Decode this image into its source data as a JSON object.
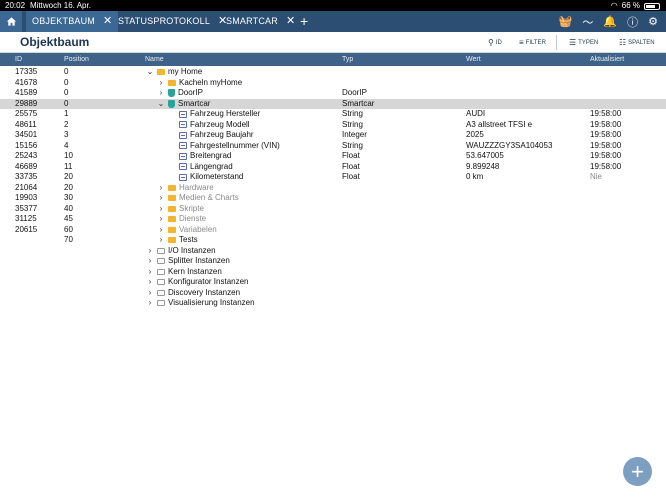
{
  "status": {
    "time": "20:02",
    "date": "Mittwoch 16. Apr.",
    "battery": "66 %"
  },
  "tabs": [
    {
      "label": "OBJEKTBAUM",
      "active": true
    },
    {
      "label": "STATUSPROTOKOLL",
      "active": false
    },
    {
      "label": "SMARTCAR",
      "active": false
    }
  ],
  "header": {
    "title": "Objektbaum",
    "id_btn": "ID",
    "filter_btn": "FILTER",
    "typen_btn": "TYPEN",
    "spalten_btn": "SPALTEN"
  },
  "columns": {
    "id": "ID",
    "position": "Position",
    "name": "Name",
    "typ": "Typ",
    "wert": "Wert",
    "aktualisiert": "Aktualisiert"
  },
  "rows": [
    {
      "id": "17335",
      "pos": "0",
      "name": "my Home",
      "typ": "",
      "wert": "",
      "akt": "",
      "indent": 0,
      "chev": "v",
      "icon": "folder",
      "muted": false,
      "sel": false
    },
    {
      "id": "41678",
      "pos": "0",
      "name": "Kacheln myHome",
      "typ": "",
      "wert": "",
      "akt": "",
      "indent": 1,
      "chev": ">",
      "icon": "folder",
      "muted": false,
      "sel": false
    },
    {
      "id": "41589",
      "pos": "0",
      "name": "DoorIP",
      "typ": "DoorIP",
      "wert": "",
      "akt": "",
      "indent": 1,
      "chev": ">",
      "icon": "inst",
      "muted": false,
      "sel": false
    },
    {
      "id": "29889",
      "pos": "0",
      "name": "Smartcar",
      "typ": "Smartcar",
      "wert": "",
      "akt": "",
      "indent": 1,
      "chev": "v",
      "icon": "inst",
      "muted": false,
      "sel": true
    },
    {
      "id": "25575",
      "pos": "1",
      "name": "Fahrzeug Hersteller",
      "typ": "String",
      "wert": "AUDI",
      "akt": "19:58:00",
      "indent": 2,
      "chev": "",
      "icon": "leaf",
      "muted": false,
      "sel": false
    },
    {
      "id": "48611",
      "pos": "2",
      "name": "Fahrzeug Modell",
      "typ": "String",
      "wert": "A3 allstreet TFSI e",
      "akt": "19:58:00",
      "indent": 2,
      "chev": "",
      "icon": "leaf",
      "muted": false,
      "sel": false
    },
    {
      "id": "34501",
      "pos": "3",
      "name": "Fahrzeug Baujahr",
      "typ": "Integer",
      "wert": "2025",
      "akt": "19:58:00",
      "indent": 2,
      "chev": "",
      "icon": "leaf",
      "muted": false,
      "sel": false
    },
    {
      "id": "15156",
      "pos": "4",
      "name": "Fahrgestellnummer (VIN)",
      "typ": "String",
      "wert": "WAUZZZGY3SA104053",
      "akt": "19:58:00",
      "indent": 2,
      "chev": "",
      "icon": "leaf",
      "muted": false,
      "sel": false
    },
    {
      "id": "25243",
      "pos": "10",
      "name": "Breitengrad",
      "typ": "Float",
      "wert": "53.647005",
      "akt": "19:58:00",
      "indent": 2,
      "chev": "",
      "icon": "leaf",
      "muted": false,
      "sel": false
    },
    {
      "id": "46689",
      "pos": "11",
      "name": "Längengrad",
      "typ": "Float",
      "wert": "9.899248",
      "akt": "19:58:00",
      "indent": 2,
      "chev": "",
      "icon": "leaf",
      "muted": false,
      "sel": false
    },
    {
      "id": "33735",
      "pos": "20",
      "name": "Kilometerstand",
      "typ": "Float",
      "wert": "0 km",
      "akt": "Nie",
      "indent": 2,
      "chev": "",
      "icon": "leaf",
      "muted": false,
      "sel": false,
      "akt_muted": true
    },
    {
      "id": "21064",
      "pos": "20",
      "name": "Hardware",
      "typ": "",
      "wert": "",
      "akt": "",
      "indent": 1,
      "chev": ">",
      "icon": "folder",
      "muted": true,
      "sel": false
    },
    {
      "id": "19903",
      "pos": "30",
      "name": "Medien & Charts",
      "typ": "",
      "wert": "",
      "akt": "",
      "indent": 1,
      "chev": ">",
      "icon": "folder",
      "muted": true,
      "sel": false
    },
    {
      "id": "35377",
      "pos": "40",
      "name": "Skripte",
      "typ": "",
      "wert": "",
      "akt": "",
      "indent": 1,
      "chev": ">",
      "icon": "folder",
      "muted": true,
      "sel": false
    },
    {
      "id": "31125",
      "pos": "45",
      "name": "Dienste",
      "typ": "",
      "wert": "",
      "akt": "",
      "indent": 1,
      "chev": ">",
      "icon": "folder",
      "muted": true,
      "sel": false
    },
    {
      "id": "20615",
      "pos": "60",
      "name": "Variabelen",
      "typ": "",
      "wert": "",
      "akt": "",
      "indent": 1,
      "chev": ">",
      "icon": "folder",
      "muted": true,
      "sel": false
    },
    {
      "id": "",
      "pos": "70",
      "name": "Tests",
      "typ": "",
      "wert": "",
      "akt": "",
      "indent": 1,
      "chev": ">",
      "icon": "folder",
      "muted": false,
      "sel": false
    },
    {
      "id": "",
      "pos": "",
      "name": "I/O Instanzen",
      "typ": "",
      "wert": "",
      "akt": "",
      "indent": 0,
      "chev": ">",
      "icon": "folder-grey",
      "muted": false,
      "sel": false
    },
    {
      "id": "",
      "pos": "",
      "name": "Splitter Instanzen",
      "typ": "",
      "wert": "",
      "akt": "",
      "indent": 0,
      "chev": ">",
      "icon": "folder-grey",
      "muted": false,
      "sel": false
    },
    {
      "id": "",
      "pos": "",
      "name": "Kern Instanzen",
      "typ": "",
      "wert": "",
      "akt": "",
      "indent": 0,
      "chev": ">",
      "icon": "folder-grey",
      "muted": false,
      "sel": false
    },
    {
      "id": "",
      "pos": "",
      "name": "Konfigurator Instanzen",
      "typ": "",
      "wert": "",
      "akt": "",
      "indent": 0,
      "chev": ">",
      "icon": "folder-grey",
      "muted": false,
      "sel": false
    },
    {
      "id": "",
      "pos": "",
      "name": "Discovery Instanzen",
      "typ": "",
      "wert": "",
      "akt": "",
      "indent": 0,
      "chev": ">",
      "icon": "folder-grey",
      "muted": false,
      "sel": false
    },
    {
      "id": "",
      "pos": "",
      "name": "Visualisierung Instanzen",
      "typ": "",
      "wert": "",
      "akt": "",
      "indent": 0,
      "chev": ">",
      "icon": "folder-grey",
      "muted": false,
      "sel": false
    }
  ],
  "fab_label": "+"
}
